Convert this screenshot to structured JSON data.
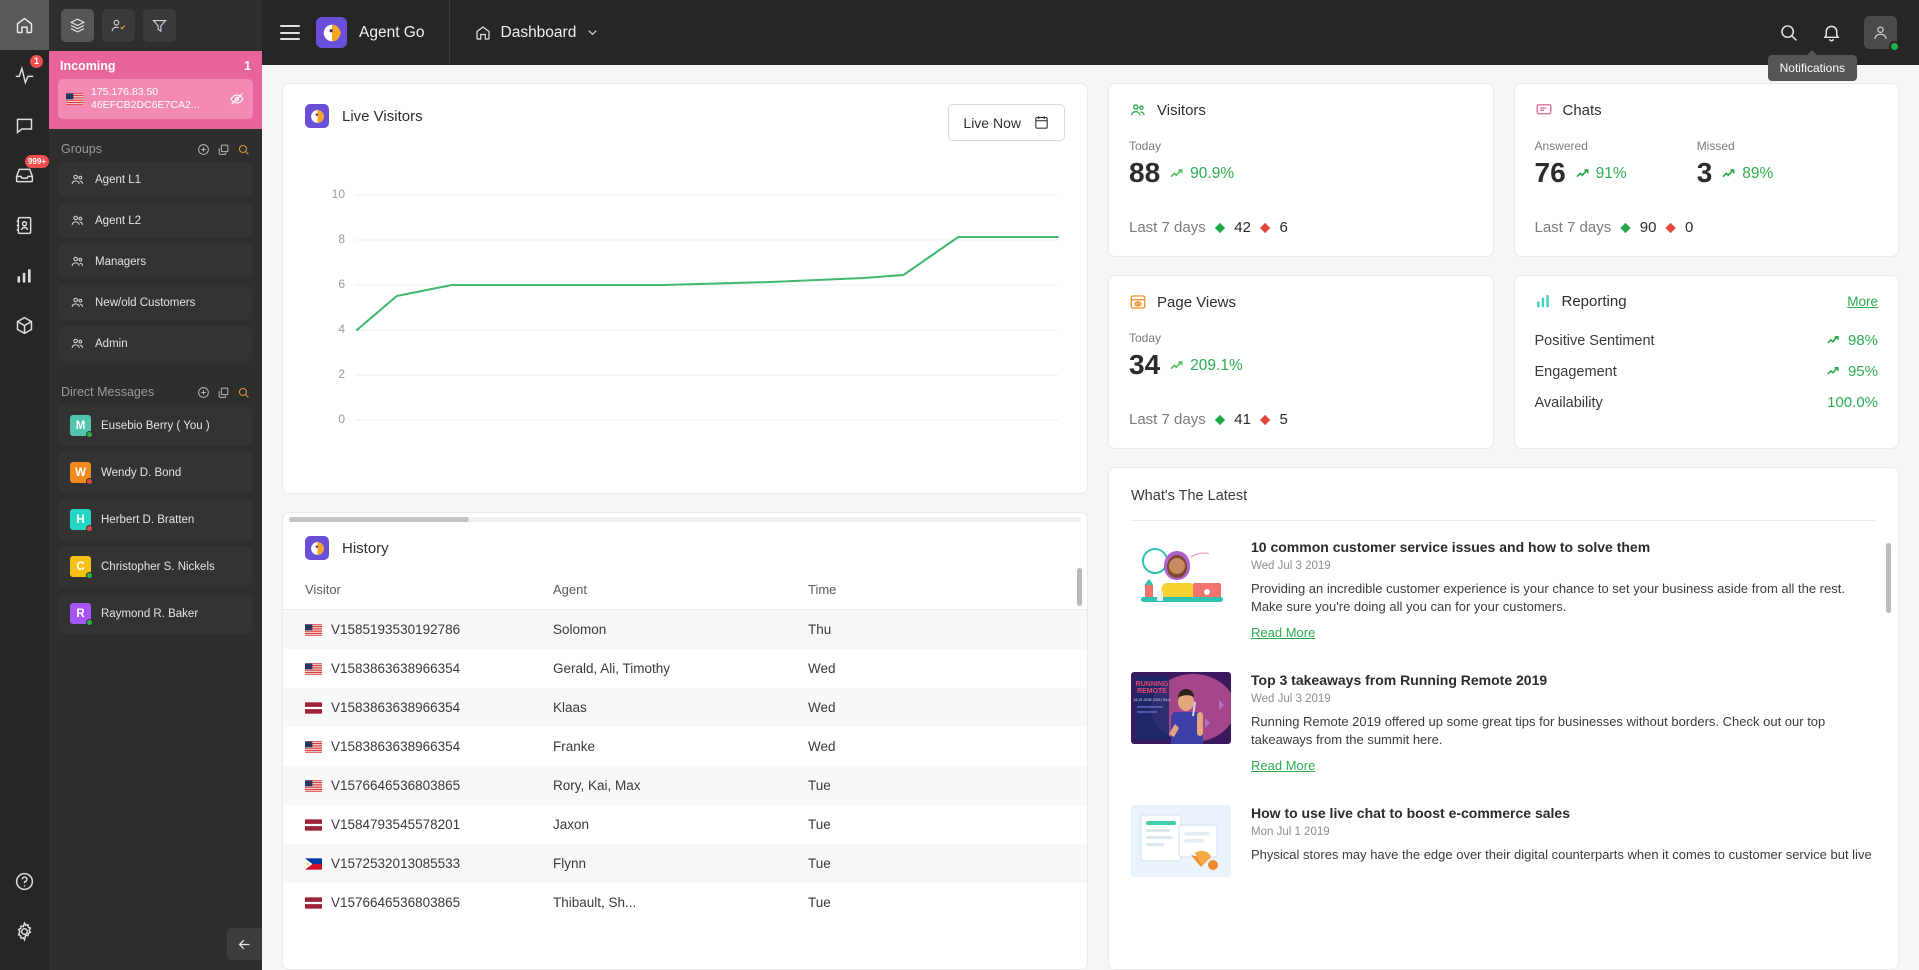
{
  "rail": {
    "items": [
      {
        "name": "home-icon",
        "badge": null,
        "active": true
      },
      {
        "name": "activity-icon",
        "badge": "1",
        "active": false
      },
      {
        "name": "chat-icon",
        "badge": null,
        "active": false
      },
      {
        "name": "inbox-icon",
        "badge": "999+",
        "active": false
      },
      {
        "name": "contacts-icon",
        "badge": null,
        "active": false
      },
      {
        "name": "analytics-icon",
        "badge": null,
        "active": false
      },
      {
        "name": "package-icon",
        "badge": null,
        "active": false
      }
    ],
    "bottom": [
      {
        "name": "help-icon"
      },
      {
        "name": "settings-icon"
      }
    ]
  },
  "panel": {
    "tools": [
      {
        "name": "layers-icon",
        "selected": true
      },
      {
        "name": "user-check-icon",
        "selected": false
      },
      {
        "name": "filter-icon",
        "selected": false
      }
    ],
    "incoming": {
      "title": "Incoming",
      "count": "1",
      "visitor": {
        "ip": "175.176.83.50",
        "id": "46EFCB2DC6E7CA2...",
        "flag": "us"
      }
    },
    "groups": {
      "title": "Groups",
      "items": [
        {
          "label": "Agent L1"
        },
        {
          "label": "Agent L2"
        },
        {
          "label": "Managers"
        },
        {
          "label": "New/old Customers"
        },
        {
          "label": "Admin"
        }
      ]
    },
    "direct_messages": {
      "title": "Direct Messages",
      "items": [
        {
          "label": "Eusebio Berry ( You )",
          "initial": "M",
          "color": "#52c4b0",
          "status": "#2db34a"
        },
        {
          "label": "Wendy D. Bond",
          "initial": "W",
          "color": "#f08a1e",
          "status": "#e8453c"
        },
        {
          "label": "Herbert D. Bratten",
          "initial": "H",
          "color": "#24d6c4",
          "status": "#e8453c"
        },
        {
          "label": "Christopher S. Nickels",
          "initial": "C",
          "color": "#f5c117",
          "status": "#2db34a"
        },
        {
          "label": "Raymond R. Baker",
          "initial": "R",
          "color": "#a855f7",
          "status": "#2db34a"
        }
      ]
    }
  },
  "topbar": {
    "brand": "Agent Go",
    "breadcrumb": "Dashboard",
    "tooltip": "Notifications"
  },
  "live_visitors": {
    "title": "Live Visitors",
    "live_now_label": "Live Now"
  },
  "chart_data": {
    "type": "line",
    "title": "Live Visitors",
    "x": [
      0,
      1,
      2,
      3,
      4,
      5,
      6,
      7,
      8,
      9
    ],
    "values": [
      4.0,
      5.5,
      6.2,
      6.2,
      6.2,
      6.3,
      6.45,
      6.55,
      8.35,
      8.35
    ],
    "series": [
      {
        "name": "Live Visitors",
        "values": [
          4.0,
          5.5,
          6.2,
          6.2,
          6.2,
          6.3,
          6.45,
          6.55,
          8.35,
          8.35
        ]
      }
    ],
    "ytick_labels": [
      "10",
      "8",
      "6",
      "4",
      "2",
      "0"
    ],
    "yticks": [
      10,
      8,
      6,
      4,
      2,
      0
    ],
    "ylim": [
      0,
      11
    ],
    "xlabel": "",
    "ylabel": "",
    "grid": true,
    "legend": "none",
    "line_color": "#43b870"
  },
  "history": {
    "title": "History",
    "columns": [
      "Visitor",
      "Agent",
      "Time"
    ],
    "rows": [
      {
        "flag": "us",
        "visitor": "V1585193530192786",
        "agent": "Solomon",
        "time": "Thu"
      },
      {
        "flag": "us",
        "visitor": "V1583863638966354",
        "agent": "Gerald, Ali, Timothy",
        "time": "Wed"
      },
      {
        "flag": "lv",
        "visitor": "V1583863638966354",
        "agent": "Klaas",
        "time": "Wed"
      },
      {
        "flag": "us",
        "visitor": "V1583863638966354",
        "agent": "Franke",
        "time": "Wed"
      },
      {
        "flag": "us",
        "visitor": "V1576646536803865",
        "agent": "Rory, Kai, Max",
        "time": "Tue"
      },
      {
        "flag": "lv",
        "visitor": "V1584793545578201",
        "agent": "Jaxon",
        "time": "Tue"
      },
      {
        "flag": "ph",
        "visitor": "V1572532013085533",
        "agent": "Flynn",
        "time": "Tue"
      },
      {
        "flag": "lv",
        "visitor": "V1576646536803865",
        "agent": "Thibault, Sh...",
        "time": "Tue"
      }
    ]
  },
  "visitors_card": {
    "title": "Visitors",
    "sub": "Today",
    "value": "88",
    "pct": "90.9%",
    "foot_label": "Last 7 days",
    "up": "42",
    "down": "6"
  },
  "chats_card": {
    "title": "Chats",
    "answered_label": "Answered",
    "missed_label": "Missed",
    "answered_value": "76",
    "answered_pct": "91%",
    "missed_value": "3",
    "missed_pct": "89%",
    "foot_label": "Last 7 days",
    "up": "90",
    "down": "0"
  },
  "page_views_card": {
    "title": "Page Views",
    "sub": "Today",
    "value": "34",
    "pct": "209.1%",
    "foot_label": "Last 7 days",
    "up": "41",
    "down": "5"
  },
  "reporting_card": {
    "title": "Reporting",
    "more": "More",
    "rows": [
      {
        "label": "Positive Sentiment",
        "value": "98%",
        "trend": true
      },
      {
        "label": "Engagement",
        "value": "95%",
        "trend": true
      },
      {
        "label": "Availability",
        "value": "100.0%",
        "trend": false
      }
    ]
  },
  "latest": {
    "title": "What's The Latest",
    "read_more": "Read More",
    "articles": [
      {
        "title": "10 common customer service issues and how to solve them",
        "date": "Wed Jul 3 2019",
        "desc": "Providing an incredible customer experience is your chance to set your business aside from all the rest. Make sure you're doing all you can for your customers.",
        "thumb": "woman-laptop"
      },
      {
        "title": "Top 3 takeaways from Running Remote 2019",
        "date": "Wed Jul 3 2019",
        "desc": "Running Remote 2019 offered up some great tips for businesses without borders. Check out our top takeaways from the summit here.",
        "thumb": "conference-stage"
      },
      {
        "title": "How to use live chat to boost e-commerce sales",
        "date": "Mon Jul 1 2019",
        "desc": "Physical stores may have the edge over their digital counterparts when it comes to customer service but live",
        "thumb": "chat-illustration"
      }
    ]
  },
  "colors": {
    "accent_green": "#2cae4e",
    "pink": "#e8649a",
    "purple": "#6c4fd8",
    "red": "#e8453c"
  }
}
